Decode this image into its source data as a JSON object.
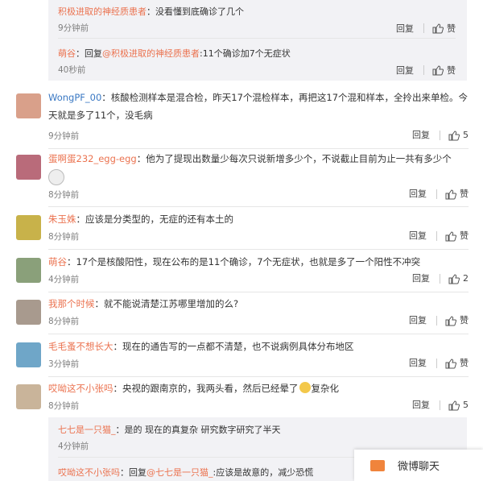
{
  "top_replies": [
    {
      "user": "积极进取的神经质患者",
      "text": "没看懂到底确诊了几个",
      "time": "9分钟前",
      "reply": "回复",
      "like": "赞"
    },
    {
      "user": "萌谷",
      "reply_prefix": "回复",
      "reply_to": "@积极进取的神经质患者",
      "text": ":11个确诊加7个无症状",
      "time": "40秒前",
      "reply": "回复",
      "like": "赞"
    }
  ],
  "comments": [
    {
      "user": "WongPF_00",
      "text": "核酸检测样本是混合检，昨天17个混检样本，再把这17个混和样本，全拎出来单检。今天就是多了11个，没毛病",
      "time": "9分钟前",
      "reply": "回复",
      "like": "5",
      "avatar_color": "#d9a08a"
    },
    {
      "user": "蛋啊蛋232_egg-egg",
      "text": "他为了提现出数量少每次只说新增多少个，不说截止目前为止一共有多少个",
      "time": "8分钟前",
      "reply": "回复",
      "like": "赞",
      "avatar_color": "#b96b7a"
    },
    {
      "user": "朱玉姝",
      "text": "应该是分类型的，无症的还有本土的",
      "time": "8分钟前",
      "reply": "回复",
      "like": "赞",
      "avatar_color": "#c8b24a"
    },
    {
      "user": "萌谷",
      "text": "17个是核酸阳性，现在公布的是11个确诊，7个无症状，也就是多了一个阳性不冲突",
      "time": "4分钟前",
      "reply": "回复",
      "like": "2",
      "avatar_color": "#8aa07a"
    },
    {
      "user": "我那个时候",
      "text": "就不能说清楚江苏哪里增加的么?",
      "time": "8分钟前",
      "reply": "回复",
      "like": "赞",
      "avatar_color": "#a89a8e"
    },
    {
      "user": "毛毛蚤不想长大",
      "text": "现在的通告写的一点都不清楚，也不说病例具体分布地区",
      "time": "3分钟前",
      "reply": "回复",
      "like": "赞",
      "avatar_color": "#6fa6c8"
    },
    {
      "user": "哎呦这不小张吗",
      "text": "央视的跟南京的，我两头看，然后已经晕了",
      "text2": "复杂化",
      "time": "8分钟前",
      "reply": "回复",
      "like": "5",
      "avatar_color": "#c9b49a"
    }
  ],
  "bottom_replies": [
    {
      "user": "七七是一只猫_",
      "text": "是的 现在的真复杂 研究数字研究了半天",
      "time": "4分钟前"
    },
    {
      "user": "哎呦这不小张吗",
      "reply_prefix": "回复",
      "reply_to": "@七七是一只猫_",
      "text": ":应该是故意的，减少恐慌"
    }
  ],
  "chat_label": "微博聊天"
}
